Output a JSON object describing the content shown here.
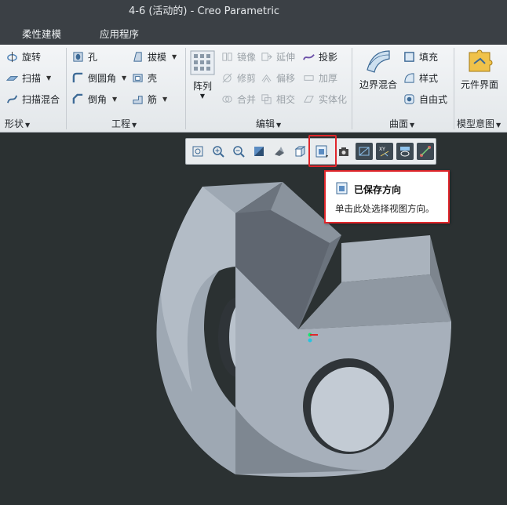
{
  "window": {
    "title": "4-6 (活动的) - Creo Parametric"
  },
  "menu": {
    "items": [
      "柔性建模",
      "应用程序"
    ]
  },
  "ribbon": {
    "shape": {
      "revolve": "旋转",
      "sweep": "扫描",
      "swept_blend": "扫描混合",
      "label": "形状"
    },
    "engineering": {
      "hole": "孔",
      "round": "倒圆角",
      "chamfer": "倒角",
      "draft": "拔模",
      "shell": "壳",
      "rib": "筋",
      "label": "工程"
    },
    "editing": {
      "pattern": "阵列",
      "mirror": "镜像",
      "trim": "修剪",
      "merge": "合并",
      "extend": "延伸",
      "offset": "偏移",
      "intersect": "相交",
      "project": "投影",
      "thicken": "加厚",
      "solidify": "实体化",
      "label": "编辑"
    },
    "surfaces": {
      "boundary_blend": "边界混合",
      "fill": "填充",
      "style": "样式",
      "freestyle": "自由式",
      "label": "曲面"
    },
    "model_intent": {
      "component_interface": "元件界面",
      "label": "模型意图"
    }
  },
  "view_toolbar": {
    "tools": [
      "refit-icon",
      "zoom-in-icon",
      "zoom-out-icon",
      "repaint-icon",
      "display-style-icon",
      "saved-orientations-icon",
      "named-views-icon",
      "section-icon",
      "datum-display-icon",
      "spin-center-icon",
      "annotation-display-icon",
      "sketch-display-icon"
    ],
    "active_tool": "saved-orientations-icon",
    "highlight_color": "#e0262b"
  },
  "tooltip": {
    "title": "已保存方向",
    "description": "单击此处选择视图方向。"
  },
  "colors": {
    "accent": "#e0262b",
    "titlebar": "#3b4045",
    "viewport": "#2b3132",
    "model": "#a7b0bb"
  }
}
